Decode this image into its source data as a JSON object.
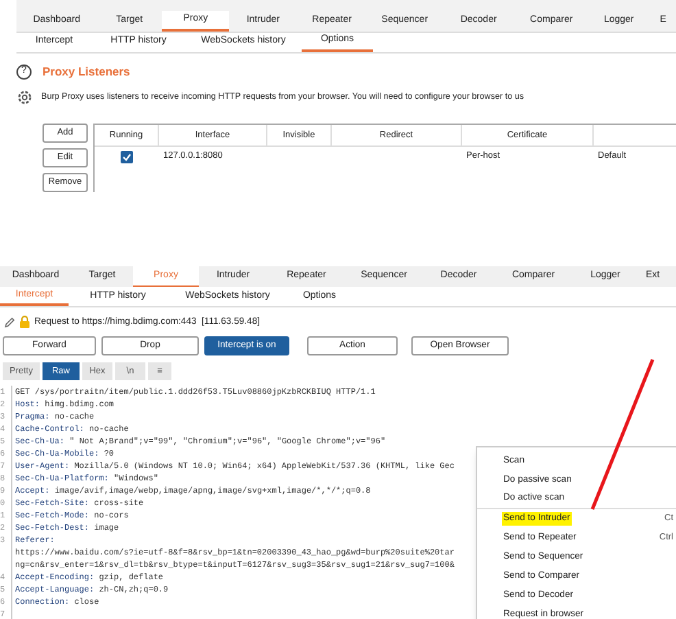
{
  "top_panel": {
    "tabs": [
      {
        "label": "Dashboard",
        "selected": false
      },
      {
        "label": "Target",
        "selected": false
      },
      {
        "label": "Proxy",
        "selected": true
      },
      {
        "label": "Intruder",
        "selected": false
      },
      {
        "label": "Repeater",
        "selected": false
      },
      {
        "label": "Sequencer",
        "selected": false
      },
      {
        "label": "Decoder",
        "selected": false
      },
      {
        "label": "Comparer",
        "selected": false
      },
      {
        "label": "Logger",
        "selected": false
      },
      {
        "label": "E",
        "selected": false
      }
    ],
    "subtabs": [
      {
        "label": "Intercept",
        "selected": false
      },
      {
        "label": "HTTP history",
        "selected": false
      },
      {
        "label": "WebSockets history",
        "selected": false
      },
      {
        "label": "Options",
        "selected": true
      }
    ],
    "help_icon": "?",
    "section_title": "Proxy Listeners",
    "description": "Burp Proxy uses listeners to receive incoming HTTP requests from your browser. You will need to configure your browser to us",
    "buttons": [
      "Add",
      "Edit",
      "Remove"
    ],
    "table": {
      "columns": [
        "Running",
        "Interface",
        "Invisible",
        "Redirect",
        "Certificate"
      ],
      "rows": [
        {
          "running": true,
          "interface": "127.0.0.1:8080",
          "certificate": "Per-host",
          "column_6": "Default"
        }
      ]
    }
  },
  "bottom_panel": {
    "tabs": [
      {
        "label": "Dashboard",
        "selected": false
      },
      {
        "label": "Target",
        "selected": false
      },
      {
        "label": "Proxy",
        "selected": true
      },
      {
        "label": "Intruder",
        "selected": false
      },
      {
        "label": "Repeater",
        "selected": false
      },
      {
        "label": "Sequencer",
        "selected": false
      },
      {
        "label": "Decoder",
        "selected": false
      },
      {
        "label": "Comparer",
        "selected": false
      },
      {
        "label": "Logger",
        "selected": false
      },
      {
        "label": "Ext",
        "selected": false
      }
    ],
    "subtabs": [
      {
        "label": "Intercept",
        "selected": true
      },
      {
        "label": "HTTP history",
        "selected": false
      },
      {
        "label": "WebSockets history",
        "selected": false
      },
      {
        "label": "Options",
        "selected": false
      }
    ],
    "request_info": "Request to https://himg.bdimg.com:443  [111.63.59.48]",
    "buttons": [
      {
        "label": "Forward",
        "active": false
      },
      {
        "label": "Drop",
        "active": false
      },
      {
        "label": "Intercept is on",
        "active": true
      },
      {
        "label": "Action",
        "active": false
      },
      {
        "label": "Open Browser",
        "active": false
      }
    ],
    "view_tabs": [
      {
        "label": "Pretty",
        "selected": false
      },
      {
        "label": "Raw",
        "selected": true
      },
      {
        "label": "Hex",
        "selected": false
      },
      {
        "label": "\\n",
        "selected": false
      },
      {
        "label": "≡",
        "selected": false
      }
    ],
    "request_lines": [
      {
        "number": "1",
        "value": "GET /sys/portraitn/item/public.1.ddd26f53.T5Luv08860jpKzbRCKBIUQ HTTP/1.1"
      },
      {
        "number": "2",
        "header": "Host:",
        "value": " himg.bdimg.com"
      },
      {
        "number": "3",
        "header": "Pragma:",
        "value": " no-cache"
      },
      {
        "number": "4",
        "header": "Cache-Control:",
        "value": " no-cache"
      },
      {
        "number": "5",
        "header": "Sec-Ch-Ua:",
        "value": " \" Not A;Brand\";v=\"99\", \"Chromium\";v=\"96\", \"Google Chrome\";v=\"96\""
      },
      {
        "number": "6",
        "header": "Sec-Ch-Ua-Mobile:",
        "value": " ?0"
      },
      {
        "number": "7",
        "header": "User-Agent:",
        "value": " Mozilla/5.0 (Windows NT 10.0; Win64; x64) AppleWebKit/537.36 (KHTML, like Gec"
      },
      {
        "number": "8",
        "header": "Sec-Ch-Ua-Platform:",
        "value": " \"Windows\""
      },
      {
        "number": "9",
        "header": "Accept:",
        "value": " image/avif,image/webp,image/apng,image/svg+xml,image/*,*/*;q=0.8"
      },
      {
        "number": "0",
        "header": "Sec-Fetch-Site:",
        "value": " cross-site"
      },
      {
        "number": "1",
        "header": "Sec-Fetch-Mode:",
        "value": " no-cors"
      },
      {
        "number": "2",
        "header": "Sec-Fetch-Dest:",
        "value": " image"
      },
      {
        "number": "3",
        "header": "Referer:"
      },
      {
        "value": "https://www.baidu.com/s?ie=utf-8&f=8&rsv_bp=1&tn=02003390_43_hao_pg&wd=burp%20suite%20tar"
      },
      {
        "value": "ng=cn&rsv_enter=1&rsv_dl=tb&rsv_btype=t&inputT=6127&rsv_sug3=35&rsv_sug1=21&rsv_sug7=100&"
      },
      {
        "number": "4",
        "header": "Accept-Encoding:",
        "value": " gzip, deflate"
      },
      {
        "number": "5",
        "header": "Accept-Language:",
        "value": " zh-CN,zh;q=0.9"
      },
      {
        "number": "6",
        "header": "Connection:",
        "value": " close"
      },
      {
        "number": "7"
      }
    ],
    "context_menu": [
      {
        "label": "Scan",
        "highlighted": false
      },
      {
        "label": "Do passive scan",
        "highlighted": false
      },
      {
        "label": "Do active scan",
        "highlighted": false,
        "divider_after": true
      },
      {
        "label": "Send to Intruder",
        "highlighted": true,
        "shortcut": "Ct"
      },
      {
        "label": "Send to Repeater",
        "highlighted": false,
        "shortcut": "Ctrl"
      },
      {
        "label": "Send to Sequencer",
        "highlighted": false
      },
      {
        "label": "Send to Comparer",
        "highlighted": false
      },
      {
        "label": "Send to Decoder",
        "highlighted": false
      },
      {
        "label": "Request in browser",
        "highlighted": false
      }
    ]
  }
}
